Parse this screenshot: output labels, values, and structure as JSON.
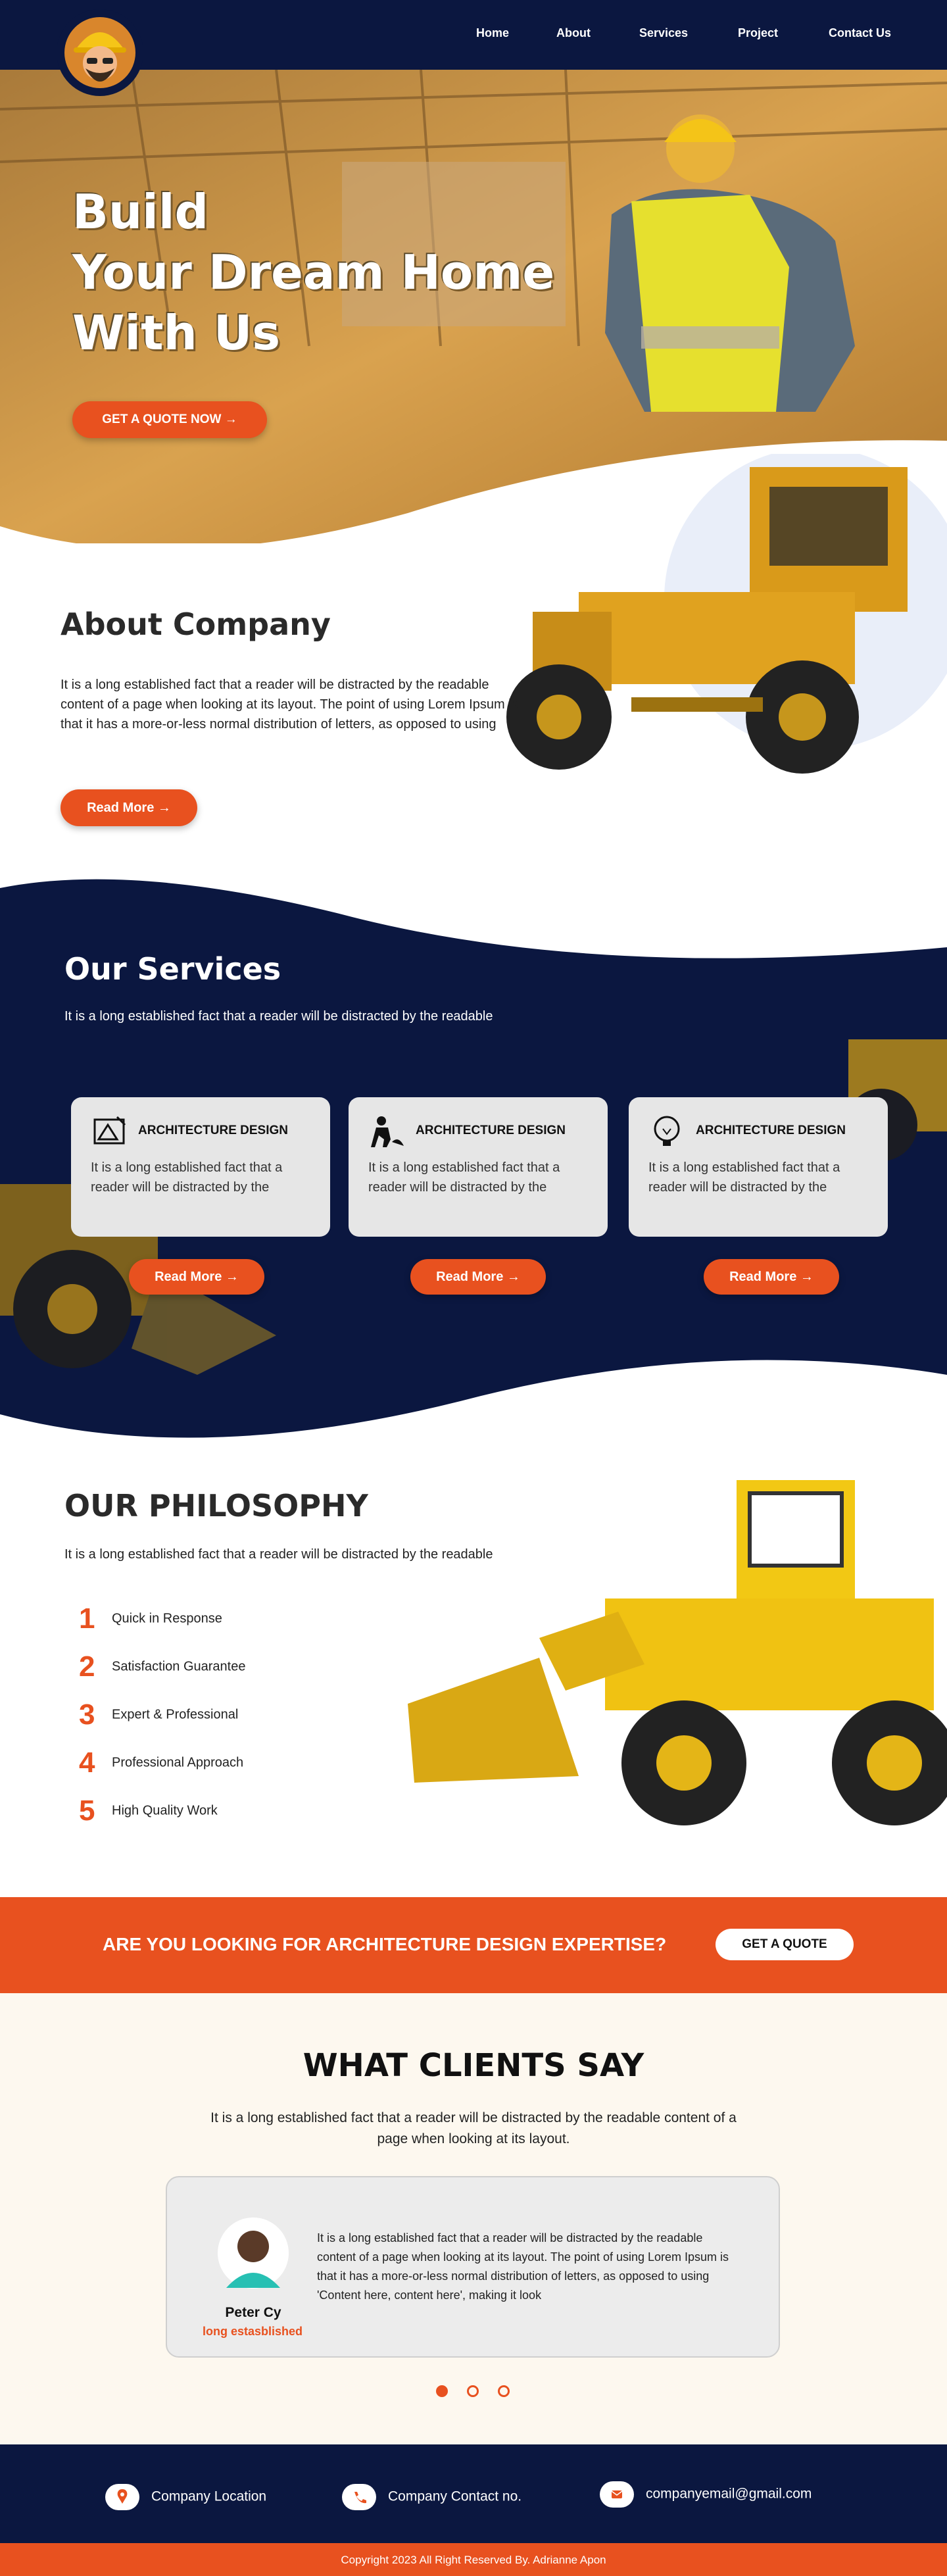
{
  "nav": {
    "items": [
      "Home",
      "About",
      "Services",
      "Project",
      "Contact Us"
    ]
  },
  "hero": {
    "title": "Build\nYour Dream Home\nWith Us",
    "cta": "GET A QUOTE NOW →"
  },
  "about": {
    "title": "About Company",
    "text": "It is a long established fact that a reader will be distracted by the readable content of a page when looking at its layout. The point of using Lorem Ipsum is that it has a more-or-less normal distribution of letters, as opposed to using",
    "cta": "Read More →"
  },
  "services": {
    "title": "Our Services",
    "subtitle": "It is a long established fact that a reader will be distracted by the readable",
    "cards": [
      {
        "icon": "architecture-drawing-icon",
        "title": "ARCHITECTURE DESIGN",
        "text": "It is a long established fact that a reader will be distracted by the",
        "cta": "Read More →"
      },
      {
        "icon": "worker-digging-icon",
        "title": "ARCHITECTURE DESIGN",
        "text": "It is a long established fact that a reader will be distracted by the",
        "cta": "Read More →"
      },
      {
        "icon": "lightbulb-icon",
        "title": "ARCHITECTURE DESIGN",
        "text": "It is a long established fact that a reader will be distracted by the",
        "cta": "Read More →"
      }
    ]
  },
  "philosophy": {
    "title": "OUR PHILOSOPHY",
    "subtitle": "It is a long established fact that a reader will be distracted by the readable",
    "items": [
      {
        "num": "1",
        "label": "Quick in Response"
      },
      {
        "num": "2",
        "label": "Satisfaction Guarantee"
      },
      {
        "num": "3",
        "label": "Expert & Professional"
      },
      {
        "num": "4",
        "label": "Professional Approach"
      },
      {
        "num": "5",
        "label": "High Quality Work"
      }
    ]
  },
  "banner": {
    "text": "ARE YOU LOOKING FOR ARCHITECTURE DESIGN EXPERTISE?",
    "cta": "GET A QUOTE"
  },
  "testimonials": {
    "title": "WHAT CLIENTS SAY",
    "subtitle": "It is a long established fact that a reader will be distracted by the readable content of a page when looking at its layout.",
    "name": "Peter Cy",
    "role": "long estasblished",
    "quote": "It is a long established fact that a reader will be distracted by the readable content of a page when looking at its layout. The point of using Lorem Ipsum is that it has a more-or-less normal distribution of letters, as opposed to using 'Content here, content here', making it look",
    "active_slide": 1,
    "slide_count": 3
  },
  "footer": {
    "location": "Company Location",
    "contact": "Company Contact no.",
    "email": "companyemail@gmail.com",
    "copyright": "Copyright 2023 All Right Reserved By. Adrianne Apon"
  },
  "colors": {
    "navy": "#0b1740",
    "accent": "#e8511f",
    "cream": "#fdf8ef"
  }
}
